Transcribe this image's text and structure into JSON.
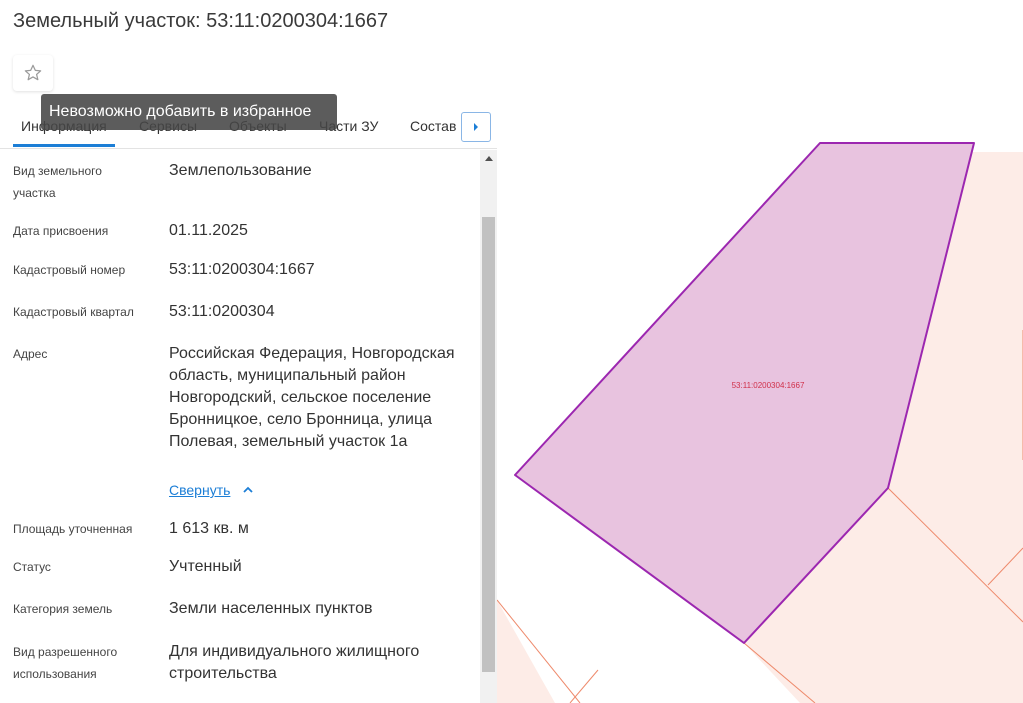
{
  "header": {
    "title": "Земельный участок: 53:11:0200304:1667"
  },
  "favorite": {
    "icon": "star-outline-icon",
    "tooltip": "Невозможно добавить в избранное"
  },
  "tabs": [
    {
      "label": "Информация",
      "active": true
    },
    {
      "label": "Сервисы"
    },
    {
      "label": "Объекты"
    },
    {
      "label": "Части ЗУ"
    },
    {
      "label": "Состав"
    }
  ],
  "info": {
    "rows": [
      {
        "label": "Вид земельного участка",
        "value": "Землепользование"
      },
      {
        "label": "Дата присвоения",
        "value": "01.11.2025"
      },
      {
        "label": "Кадастровый номер",
        "value": "53:11:0200304:1667"
      },
      {
        "label": "Кадастровый квартал",
        "value": "53:11:0200304"
      },
      {
        "label": "Адрес",
        "value": "Российская Федерация, Новгородская область, муниципальный район Новгородский, сельское поселение Бронницкое, село Бронница, улица Полевая, земельный участок 1а"
      },
      {
        "label": "Площадь уточненная",
        "value": "1 613 кв. м"
      },
      {
        "label": "Статус",
        "value": "Учтенный"
      },
      {
        "label": "Категория земель",
        "value": "Земли населенных пунктов"
      },
      {
        "label": "Вид разрешенного использования",
        "value": "Для индивидуального жилищного строительства"
      }
    ],
    "collapse_label": "Свернуть"
  },
  "map": {
    "parcel_label": "53:11:0200304:1667",
    "colors": {
      "parcel_fill": "#e8c3df",
      "parcel_stroke": "#9c27b0",
      "neighbor_fill": "#fdece7",
      "neighbor_stroke": "#ee8a6c",
      "label": "#d0304a"
    }
  }
}
